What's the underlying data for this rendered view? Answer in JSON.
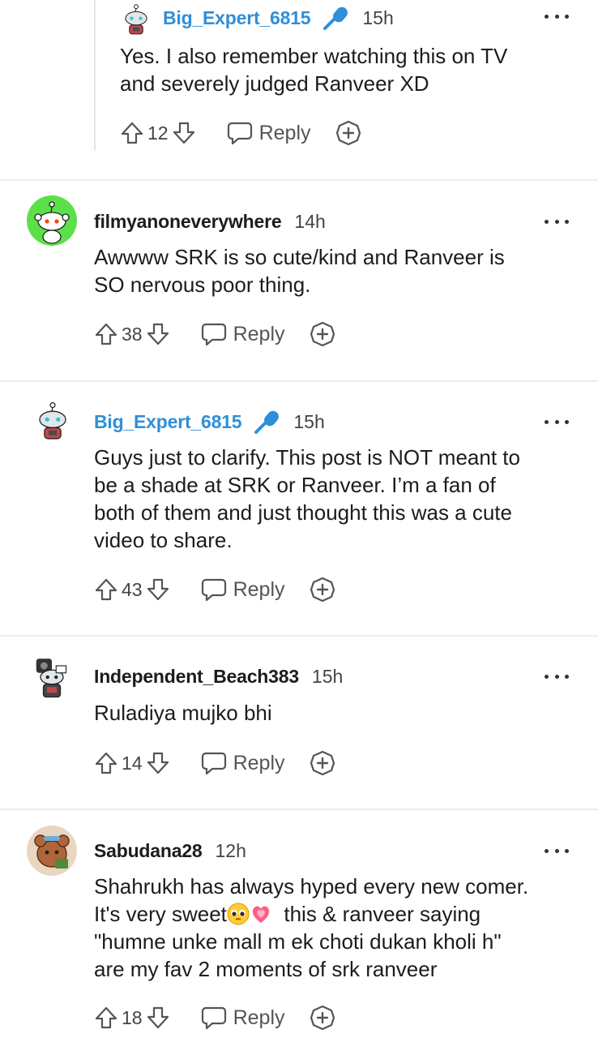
{
  "comments": [
    {
      "username": "Big_Expert_6815",
      "is_op": true,
      "time": "15h",
      "lines": [
        "Yes. I also remember watching this on TV",
        "and severely judged Ranveer XD"
      ],
      "votes": "12",
      "reply_label": "Reply"
    },
    {
      "username": "filmyanoneverywhere",
      "is_op": false,
      "time": "14h",
      "lines": [
        "Awwww SRK is so cute/kind and Ranveer is",
        "SO nervous poor thing."
      ],
      "votes": "38",
      "reply_label": "Reply"
    },
    {
      "username": "Big_Expert_6815",
      "is_op": true,
      "time": "15h",
      "lines": [
        "Guys just to clarify. This post is NOT meant to",
        "be a shade at SRK or Ranveer. I’m a fan of",
        "both of them and just thought this was a cute",
        "video to share."
      ],
      "votes": "43",
      "reply_label": "Reply"
    },
    {
      "username": "Independent_Beach383",
      "is_op": false,
      "time": "15h",
      "lines": [
        "Ruladiya mujko bhi"
      ],
      "votes": "14",
      "reply_label": "Reply"
    },
    {
      "username": "Sabudana28",
      "is_op": false,
      "time": "12h",
      "lines": [
        "Shahrukh has always hyped every new comer.",
        "It's very sweet",
        "this & ranveer saying",
        "\"humne unke mall m ek choti dukan kholi h\"",
        "are my fav 2 moments of srk ranveer"
      ],
      "votes": "18",
      "reply_label": "Reply"
    }
  ],
  "icons": {
    "upvote": "arrow-up-outline-icon",
    "downvote": "arrow-down-outline-icon",
    "reply": "speech-bubble-icon",
    "award": "plus-circle-icon",
    "more": "three-dots-icon",
    "flair": "microphone-icon",
    "emoji_1": "pleading-face-emoji",
    "emoji_2": "growing-heart-emoji"
  },
  "colors": {
    "op_username": "#2f8fd8",
    "divider": "#ececec",
    "avatar_green": "#5ce04a"
  }
}
